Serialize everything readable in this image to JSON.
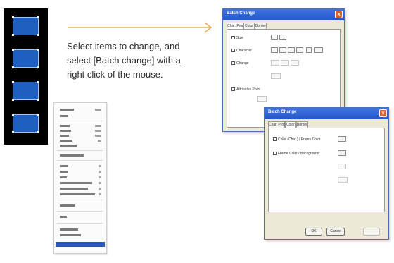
{
  "instruction": {
    "line1": "Select items to change, and",
    "line2": "select [Batch change] with a",
    "line3": "right click of the mouse."
  },
  "arrow_color": "#f0a030",
  "dialog_back": {
    "title": "Batch Change",
    "tabs": [
      "Char. Prop.",
      "Color",
      "Border"
    ],
    "rows": [
      "Size",
      "Character",
      "Change",
      "",
      "Attributes Point",
      ""
    ]
  },
  "dialog_front": {
    "title": "Batch Change",
    "tabs": [
      "Char. Prop.",
      "Color",
      "Border"
    ],
    "rows": [
      "Color (Char.) / Frame Color",
      "Frame Color / Background"
    ],
    "ok_label": "OK",
    "cancel_label": "Cancel"
  },
  "colors": {
    "selection_blue": "#1f5fbf",
    "titlebar": "#2457c9",
    "menu_highlight": "#2b56b8"
  }
}
